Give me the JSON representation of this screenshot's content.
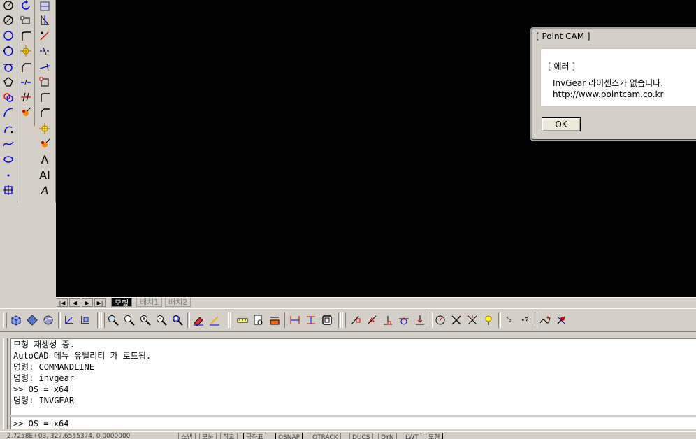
{
  "layout_tabs": [
    {
      "label": "모형",
      "active": true
    },
    {
      "label": "배치1",
      "active": false
    },
    {
      "label": "배치2",
      "active": false
    }
  ],
  "nav_buttons": [
    "|◀",
    "◀",
    "▶",
    "▶|"
  ],
  "command_history": [
    "모형 재생성 중.",
    "AutoCAD 메뉴 유틸리티 가 로드됨.",
    "명령: COMMANDLINE",
    "명령: invgear",
    ">> OS = x64",
    "명령:  INVGEAR"
  ],
  "command_input": ">> OS = x64",
  "dialog": {
    "title": "[ Point CAM ]",
    "heading": "[ 에러 ]",
    "message": "InvGear 라이센스가 없습니다.",
    "url": "http://www.pointcam.co.kr",
    "ok_label": "OK"
  },
  "status_bar": {
    "coordinates": "2.7258E+03, 327.6555374,  0.0000000",
    "toggles": [
      "스냅",
      "모눈",
      "직교",
      "극좌표",
      "OSNAP",
      "OTRACK",
      "DUCS",
      "DYN",
      "LWT",
      "모형"
    ]
  },
  "colors": {
    "canvas": "#000000",
    "chrome": "#d4d0c8",
    "active_toggle_border": "#000000"
  }
}
